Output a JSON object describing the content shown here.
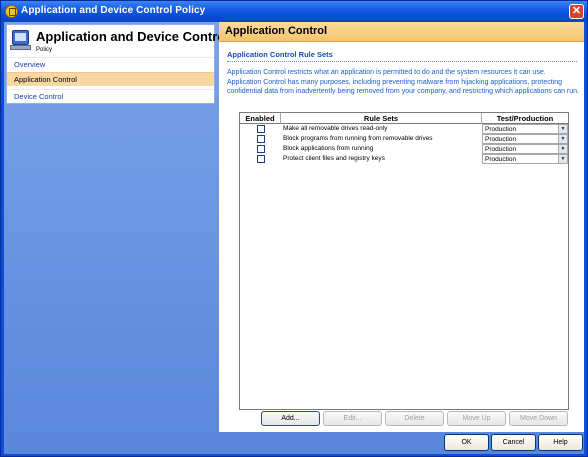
{
  "window": {
    "title": "Application and Device Control Policy",
    "close_glyph": "✕"
  },
  "leftpane": {
    "title": "Application and Device Control",
    "subtitle": "Policy",
    "items": [
      {
        "label": "Overview"
      },
      {
        "label": "Application Control"
      },
      {
        "label": "Device Control"
      }
    ]
  },
  "main": {
    "header": "Application Control",
    "section_title": "Application Control Rule Sets",
    "description": "Application Control restricts what an application is permitted to do and the system resources it can use. Application Control has many purposes, including preventing malware from hijacking applications, protecting confidential data from inadvertently being removed from your company, and restricting which applications can run.",
    "grid": {
      "columns": [
        "Enabled",
        "Rule Sets",
        "Test/Production"
      ],
      "rows": [
        {
          "enabled": false,
          "rule_set": "Make all removable drives read-only",
          "mode": "Production"
        },
        {
          "enabled": false,
          "rule_set": "Block programs from running from removable drives",
          "mode": "Production"
        },
        {
          "enabled": false,
          "rule_set": "Block applications from running",
          "mode": "Production"
        },
        {
          "enabled": false,
          "rule_set": "Protect client files and registry keys",
          "mode": "Production"
        }
      ]
    },
    "buttons": {
      "add": "Add...",
      "edit": "Edit...",
      "delete": "Delete",
      "move_up": "Move Up",
      "move_down": "Move Down"
    }
  },
  "footer": {
    "ok": "OK",
    "cancel": "Cancel",
    "help": "Help"
  },
  "colors": {
    "titlebar": "#0b4fd8",
    "header_accent": "#f3c46e",
    "selected_item": "#f9d7a3",
    "link_text": "#1a5fcf"
  }
}
